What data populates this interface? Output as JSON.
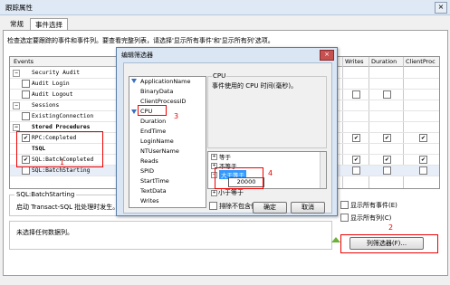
{
  "window": {
    "title": "跟踪属性",
    "close_icon": "×"
  },
  "tabs": [
    {
      "label": "常规"
    },
    {
      "label": "事件选择"
    }
  ],
  "instructions": "检查选定要跟踪的事件和事件列。要查看完整列表，请选择'显示所有事件'和'显示所有列'选项。",
  "grid": {
    "headers": {
      "events": "Events",
      "writes": "Writes",
      "duration": "Duration",
      "client_process": "ClientProc"
    },
    "rows": [
      {
        "label": "Security Audit",
        "type": "category"
      },
      {
        "label": "Audit Login",
        "type": "event",
        "checked": false
      },
      {
        "label": "Audit Logout",
        "type": "event",
        "checked": false
      },
      {
        "label": "Sessions",
        "type": "category"
      },
      {
        "label": "ExistingConnection",
        "type": "event",
        "checked": false
      },
      {
        "label": "Stored Procedures",
        "type": "category"
      },
      {
        "label": "RPC:Completed",
        "type": "event",
        "checked": true
      },
      {
        "label": "TSQL",
        "type": "category"
      },
      {
        "label": "SQL:BatchCompleted",
        "type": "event",
        "checked": true
      },
      {
        "label": "SQL:BatchStarting",
        "type": "event",
        "checked": false
      }
    ]
  },
  "description": {
    "title": "SQL:BatchStarting",
    "text": "启动 Transact-SQL 批处理时发生。"
  },
  "selection_note": "未选择任何数据列。",
  "options": {
    "show_all_events": "显示所有事件(E)",
    "show_all_columns": "显示所有列(C)"
  },
  "column_filter_button": "列筛选器(F)...",
  "annotations": {
    "n1": "1",
    "n2": "2",
    "n3": "3",
    "n4": "4"
  },
  "filter_dialog": {
    "title": "编辑筛选器",
    "columns": [
      "ApplicationName",
      "BinaryData",
      "ClientProcessID",
      "CPU",
      "Duration",
      "EndTime",
      "LoginName",
      "NTUserName",
      "Reads",
      "SPID",
      "StartTime",
      "TextData",
      "Writes"
    ],
    "selected_column": "CPU",
    "column_header": "CPU",
    "column_description": "事件使用的 CPU 时间(毫秒)。",
    "operators": [
      "等于",
      "不等于",
      "大于等于",
      "小于等于"
    ],
    "value": "20000",
    "exclude_null_label": "排除不包含值的行(E)",
    "ok": "确定",
    "cancel": "取消"
  },
  "colors": {
    "annotation": "#e00000",
    "selection": "#3399ff"
  }
}
